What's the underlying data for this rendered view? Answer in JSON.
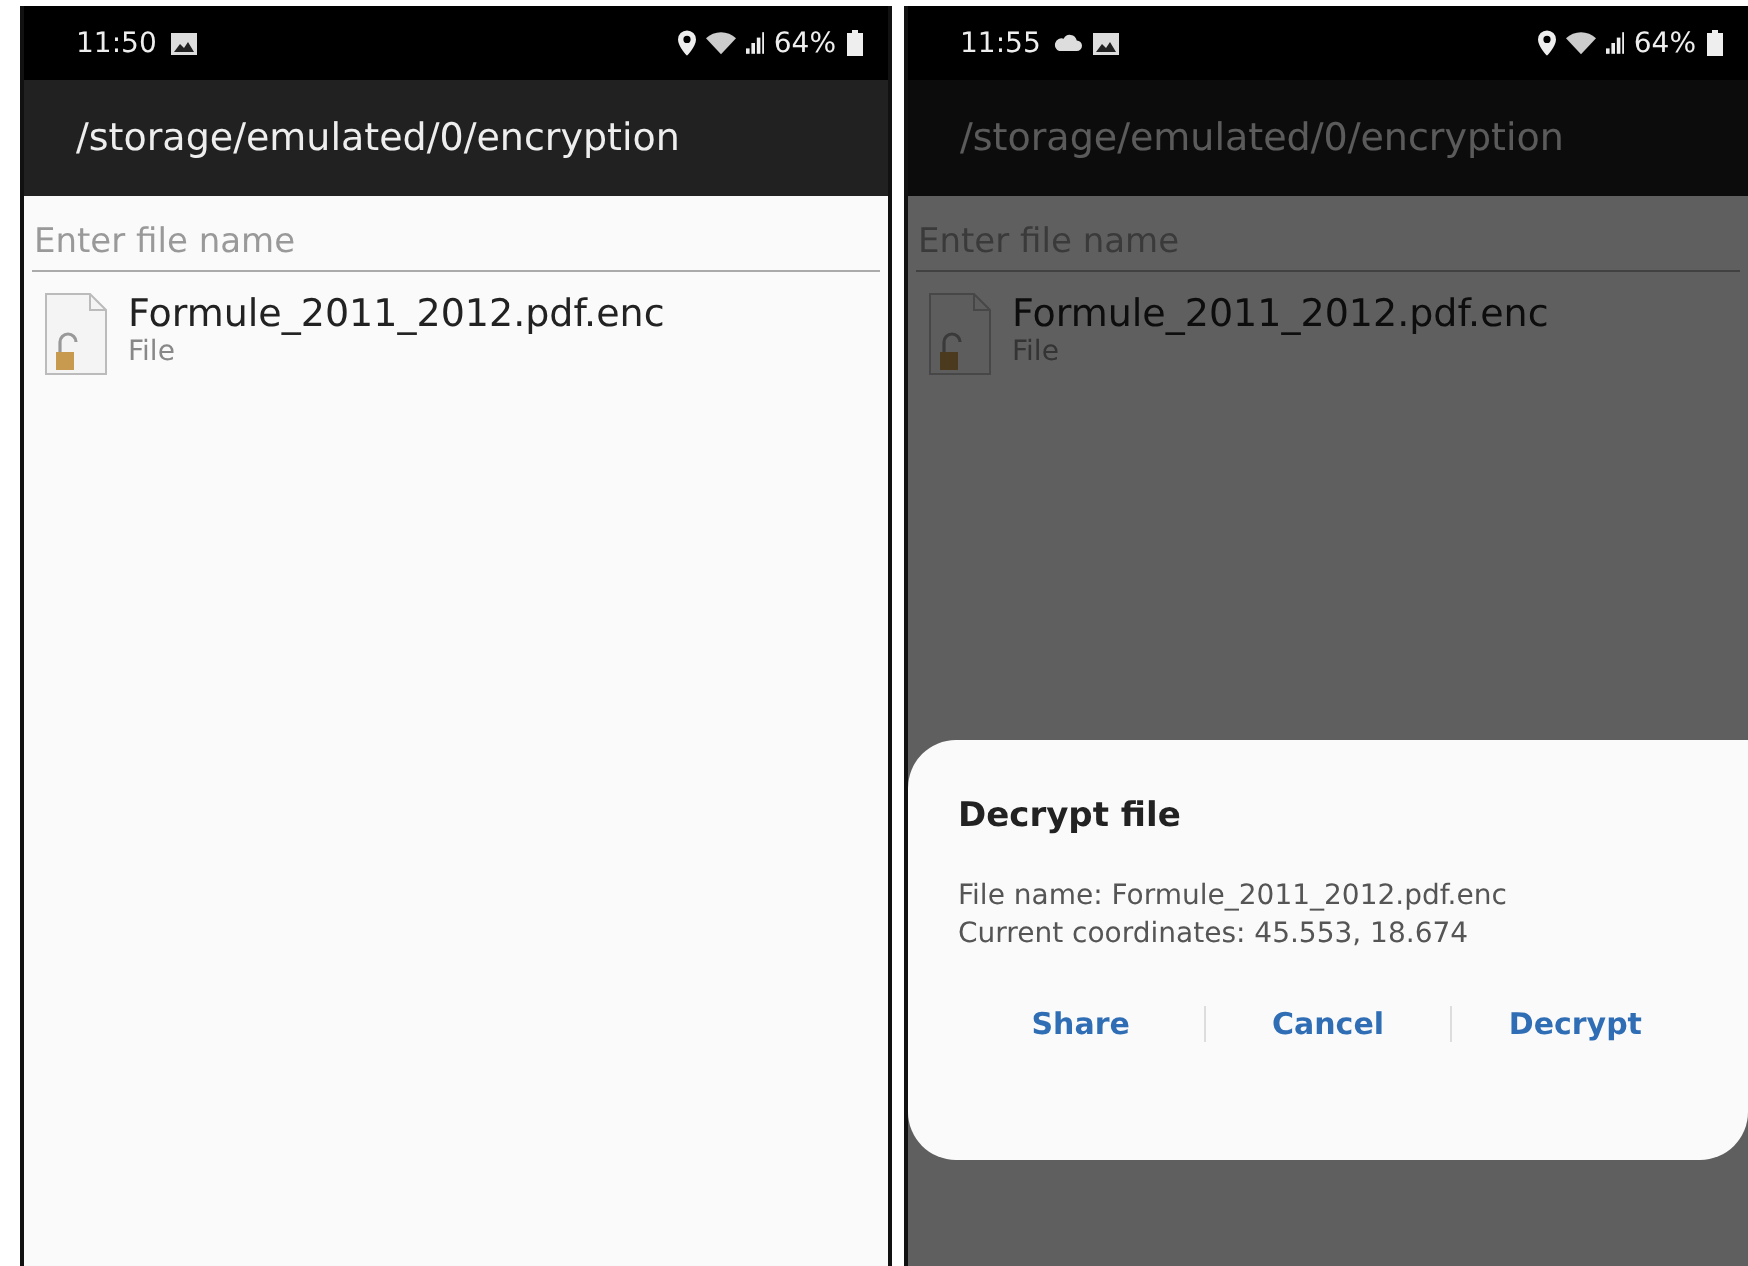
{
  "screens": [
    {
      "status_bar": {
        "time": "11:50",
        "notifications": [
          {
            "kind": "image"
          }
        ],
        "battery": "64%"
      },
      "title": "/storage/emulated/0/encryption",
      "search": {
        "placeholder": "Enter file name"
      },
      "files": [
        {
          "name": "Formule_2011_2012.pdf.enc",
          "type": "File"
        }
      ],
      "dimmed": false
    },
    {
      "status_bar": {
        "time": "11:55",
        "notifications": [
          {
            "kind": "cloud"
          },
          {
            "kind": "image"
          }
        ],
        "battery": "64%"
      },
      "title": "/storage/emulated/0/encryption",
      "search": {
        "placeholder": "Enter file name"
      },
      "files": [
        {
          "name": "Formule_2011_2012.pdf.enc",
          "type": "File"
        }
      ],
      "dimmed": true,
      "dialog": {
        "title": "Decrypt file",
        "lines": [
          "File name: Formule_2011_2012.pdf.enc",
          "Current coordinates: 45.553, 18.674"
        ],
        "buttons": [
          "Share",
          "Cancel",
          "Decrypt"
        ]
      }
    }
  ]
}
